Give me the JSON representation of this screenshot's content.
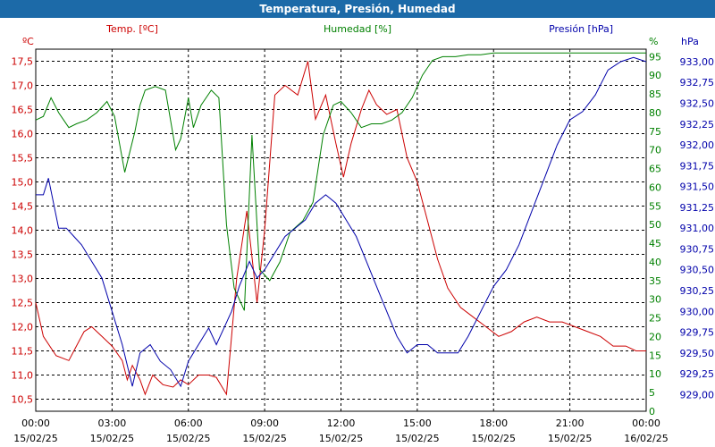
{
  "window": {
    "title": "Temperatura, Presión, Humedad"
  },
  "chart_data": {
    "type": "line",
    "title": "Temperatura, Presión, Humedad",
    "x_ticks": [
      "00:00",
      "03:00",
      "06:00",
      "09:00",
      "12:00",
      "15:00",
      "18:00",
      "21:00",
      "00:00"
    ],
    "x_dates": [
      "15/02/25",
      "15/02/25",
      "15/02/25",
      "15/02/25",
      "15/02/25",
      "15/02/25",
      "15/02/25",
      "15/02/25",
      "16/02/25"
    ],
    "x_range_hours": [
      0,
      24
    ],
    "grid": true,
    "axes": {
      "temp": {
        "label": "Temp. [ºC]",
        "unit": "ºC",
        "color": "#cc0000",
        "min": 10.25,
        "max": 17.75,
        "ticks": [
          "10,5",
          "11,0",
          "11,5",
          "12,0",
          "12,5",
          "13,0",
          "13,5",
          "14,0",
          "14,5",
          "15,0",
          "15,5",
          "16,0",
          "16,5",
          "17,0",
          "17,5"
        ]
      },
      "hum": {
        "label": "Humedad [%]",
        "unit": "%",
        "color": "#008000",
        "min": 0,
        "max": 97,
        "ticks": [
          "0",
          "5",
          "10",
          "15",
          "20",
          "25",
          "30",
          "35",
          "40",
          "45",
          "50",
          "55",
          "60",
          "65",
          "70",
          "75",
          "80",
          "85",
          "90",
          "95"
        ]
      },
      "pres": {
        "label": "Presión [hPa]",
        "unit": "hPa",
        "color": "#0000aa",
        "min": 928.8,
        "max": 933.15,
        "ticks": [
          "929,00",
          "929,25",
          "929,50",
          "929,75",
          "930,00",
          "930,25",
          "930,50",
          "930,75",
          "931,00",
          "931,25",
          "931,50",
          "931,75",
          "932,00",
          "932,25",
          "932,50",
          "932,75",
          "933,00"
        ]
      }
    },
    "series": [
      {
        "name": "Temp. [ºC]",
        "axis": "temp",
        "color": "#cc0000",
        "x": [
          0,
          0.3,
          0.8,
          1.3,
          1.6,
          1.9,
          2.2,
          2.6,
          3.0,
          3.4,
          3.6,
          3.8,
          4.1,
          4.3,
          4.6,
          5.0,
          5.4,
          5.7,
          6.0,
          6.4,
          6.8,
          7.1,
          7.5,
          7.9,
          8.3,
          8.7,
          9.0,
          9.4,
          9.8,
          10.3,
          10.7,
          11.0,
          11.4,
          11.8,
          12.1,
          12.4,
          12.8,
          13.1,
          13.4,
          13.8,
          14.2,
          14.6,
          15.0,
          15.4,
          15.8,
          16.2,
          16.7,
          17.2,
          17.7,
          18.2,
          18.7,
          19.2,
          19.7,
          20.2,
          20.7,
          21.2,
          21.7,
          22.2,
          22.7,
          23.2,
          23.6,
          24.0
        ],
        "values": [
          12.5,
          11.8,
          11.4,
          11.3,
          11.6,
          11.9,
          12.0,
          11.8,
          11.6,
          11.3,
          10.9,
          11.2,
          10.9,
          10.6,
          11.0,
          10.8,
          10.75,
          10.9,
          10.8,
          11.0,
          11.0,
          10.95,
          10.6,
          13.0,
          14.4,
          12.5,
          14.0,
          16.8,
          17.0,
          16.8,
          17.5,
          16.3,
          16.8,
          15.8,
          15.1,
          15.8,
          16.5,
          16.9,
          16.6,
          16.4,
          16.5,
          15.5,
          15.0,
          14.2,
          13.4,
          12.8,
          12.4,
          12.2,
          12.0,
          11.8,
          11.9,
          12.1,
          12.2,
          12.1,
          12.1,
          12.0,
          11.9,
          11.8,
          11.6,
          11.6,
          11.5,
          11.5
        ]
      },
      {
        "name": "Humedad [%]",
        "axis": "hum",
        "color": "#008000",
        "x": [
          0,
          0.3,
          0.6,
          0.9,
          1.3,
          1.6,
          2.0,
          2.4,
          2.8,
          3.1,
          3.5,
          3.9,
          4.1,
          4.3,
          4.7,
          5.1,
          5.5,
          5.7,
          6.0,
          6.2,
          6.5,
          6.9,
          7.2,
          7.5,
          7.8,
          8.2,
          8.5,
          8.8,
          9.2,
          9.6,
          10.0,
          10.5,
          10.9,
          11.3,
          11.7,
          12.0,
          12.4,
          12.8,
          13.2,
          13.6,
          14.0,
          14.4,
          14.8,
          15.2,
          15.6,
          16.0,
          16.5,
          17.0,
          17.5,
          18.0,
          19.0,
          20.0,
          21.0,
          22.0,
          23.0,
          23.6,
          24.0
        ],
        "values": [
          78,
          79,
          84,
          80,
          76,
          77,
          78,
          80,
          83,
          79,
          64,
          75,
          82,
          86,
          87,
          86,
          70,
          73,
          84,
          76,
          82,
          86,
          84,
          50,
          33,
          27,
          74,
          38,
          35,
          40,
          48,
          51,
          56,
          74,
          82,
          83,
          80,
          76,
          77,
          77,
          78,
          80,
          84,
          90,
          94,
          95,
          95,
          95.5,
          95.5,
          96,
          96,
          96,
          96,
          96,
          96,
          96,
          96
        ]
      },
      {
        "name": "Presión [hPa]",
        "axis": "pres",
        "color": "#0000aa",
        "x": [
          0,
          0.3,
          0.5,
          0.9,
          1.2,
          1.5,
          1.8,
          2.2,
          2.6,
          3.0,
          3.4,
          3.8,
          4.1,
          4.5,
          4.9,
          5.3,
          5.7,
          6.0,
          6.4,
          6.8,
          7.1,
          7.4,
          7.7,
          8.0,
          8.4,
          8.7,
          9.0,
          9.4,
          9.8,
          10.2,
          10.6,
          11.0,
          11.4,
          11.8,
          12.2,
          12.6,
          13.0,
          13.4,
          13.8,
          14.2,
          14.6,
          15.0,
          15.4,
          15.8,
          16.2,
          16.6,
          17.0,
          17.5,
          18.0,
          18.5,
          19.0,
          19.5,
          20.0,
          20.5,
          21.0,
          21.5,
          22.0,
          22.5,
          23.0,
          23.5,
          24.0
        ],
        "values": [
          931.4,
          931.4,
          931.6,
          931.0,
          931.0,
          930.9,
          930.8,
          930.6,
          930.4,
          930.0,
          929.6,
          929.1,
          929.5,
          929.6,
          929.4,
          929.3,
          929.1,
          929.4,
          929.6,
          929.8,
          929.6,
          929.8,
          930.0,
          930.3,
          930.6,
          930.4,
          930.5,
          930.7,
          930.9,
          931.0,
          931.1,
          931.3,
          931.4,
          931.3,
          931.1,
          930.9,
          930.6,
          930.3,
          930.0,
          929.7,
          929.5,
          929.6,
          929.6,
          929.5,
          929.5,
          929.5,
          929.7,
          930.0,
          930.3,
          930.5,
          930.8,
          931.2,
          931.6,
          932.0,
          932.3,
          932.4,
          932.6,
          932.9,
          933.0,
          933.05,
          933.0
        ]
      }
    ]
  }
}
